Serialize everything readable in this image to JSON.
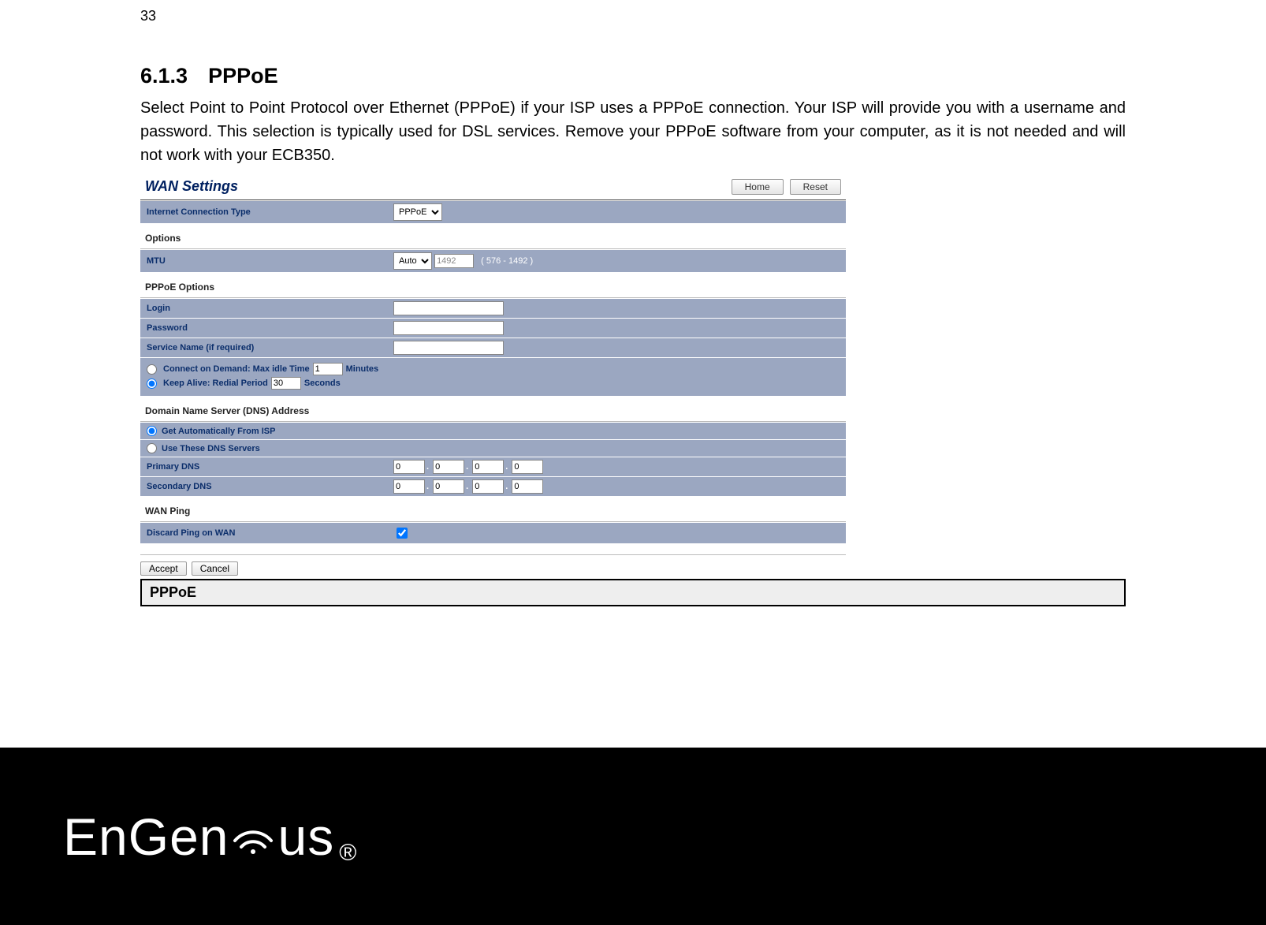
{
  "page_number": "33",
  "section_number": "6.1.3",
  "section_title": "PPPoE",
  "paragraph": "Select Point to Point Protocol over Ethernet (PPPoE) if your ISP uses a PPPoE connection. Your ISP will provide you with a username and password. This selection is typically used for DSL services. Remove your PPPoE software from your computer, as it is not needed and will not work with your ECB350.",
  "header": {
    "title": "WAN Settings",
    "home": "Home",
    "reset": "Reset"
  },
  "conn_type": {
    "label": "Internet Connection Type",
    "value": "PPPoE"
  },
  "options_head": "Options",
  "mtu": {
    "label": "MTU",
    "mode": "Auto",
    "value": "1492",
    "range": "( 576 - 1492 )"
  },
  "pppoe_head": "PPPoE Options",
  "login": {
    "label": "Login",
    "value": ""
  },
  "password": {
    "label": "Password",
    "value": ""
  },
  "service": {
    "label": "Service Name (if required)",
    "value": ""
  },
  "demand": {
    "label_before": "Connect on Demand: Max idle Time",
    "value": "1",
    "label_after": "Minutes"
  },
  "keepalive": {
    "label_before": "Keep Alive: Redial Period",
    "value": "30",
    "label_after": "Seconds"
  },
  "dns_head": "Domain Name Server (DNS) Address",
  "dns_auto": "Get Automatically From ISP",
  "dns_manual": "Use These DNS Servers",
  "primary_dns": {
    "label": "Primary DNS",
    "a": "0",
    "b": "0",
    "c": "0",
    "d": "0"
  },
  "secondary_dns": {
    "label": "Secondary DNS",
    "a": "0",
    "b": "0",
    "c": "0",
    "d": "0"
  },
  "wanping_head": "WAN Ping",
  "discard": {
    "label": "Discard Ping on WAN"
  },
  "accept": "Accept",
  "cancel": "Cancel",
  "caption": "PPPoE",
  "brand": {
    "pre": "EnGen",
    "post": "us"
  }
}
